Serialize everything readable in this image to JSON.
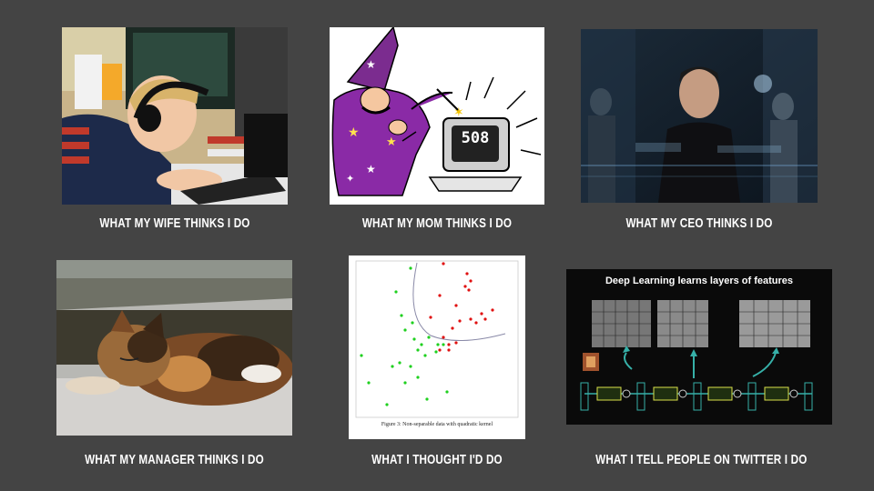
{
  "captions": {
    "wife": "WHAT MY WIFE THINKS I DO",
    "mom": "WHAT MY MOM THINKS I DO",
    "ceo": "WHAT MY CEO THINKS I DO",
    "manager": "WHAT MY MANAGER THINKS I DO",
    "thought": "WHAT I THOUGHT I'D DO",
    "twitter": "WHAT I TELL PEOPLE ON TWITTER I DO"
  },
  "wizard_screen_text": "508",
  "scatter_caption": "Figure 3: Non-separable data with quadratic kernel",
  "deep_learning_title": "Deep Learning learns layers of features"
}
